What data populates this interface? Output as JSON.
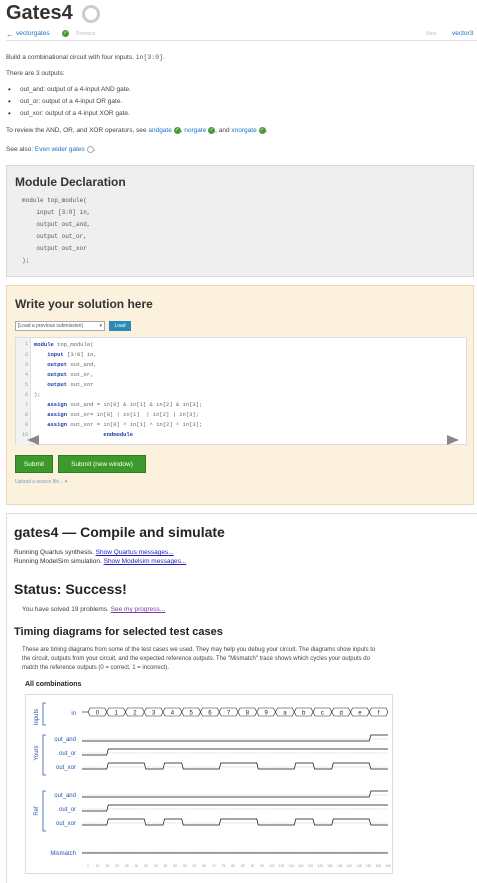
{
  "header": {
    "title": "Gates4",
    "back_link": "vectorgates",
    "previous_label": "Previous",
    "next_label": "Next",
    "next_link": "vector3"
  },
  "problem": {
    "intro_prefix": "Build a combinational circuit with four inputs, ",
    "intro_code": "in[3:0]",
    "intro_suffix": ".",
    "outputs_count": "There are 3 outputs:",
    "outputs": [
      "out_and: output of a 4-input AND gate.",
      "out_or: output of a 4-input OR gate.",
      "out_xor: output of a 4-input XOR gate."
    ],
    "review_prefix": "To review the AND, OR, and XOR operators, see ",
    "review_links": [
      "andgate",
      "norgate",
      "xnorgate"
    ],
    "review_sep1": ", ",
    "review_sep2": ", and ",
    "review_end": ".",
    "see_also_prefix": "See also: ",
    "see_also_link": "Even wider gates",
    "see_also_end": "."
  },
  "declaration": {
    "title": "Module Declaration",
    "lines": [
      "module top_module(",
      "    input [3:0] in,",
      "    output out_and,",
      "    output out_or,",
      "    output out_xor",
      ");"
    ]
  },
  "solution": {
    "title": "Write your solution here",
    "select_value": "[Load a previous submission]",
    "load_label": "Load",
    "line_numbers": [
      "1",
      "2",
      "3",
      "4",
      "5",
      "6",
      "7",
      "8",
      "9",
      "10"
    ],
    "submit_label": "Submit",
    "submit_new_label": "Submit (new window)",
    "upload_label": "Upload a source file..."
  },
  "results": {
    "title": "gates4 — Compile and simulate",
    "line1_prefix": "Running Quartus synthesis. ",
    "line1_link": "Show Quartus messages...",
    "line2_prefix": "Running ModelSim simulation. ",
    "line2_link": "Show Modelsim messages...",
    "status": "Status: Success!",
    "solved_prefix": "You have solved 19 problems. ",
    "solved_link": "See my progress...",
    "timing_title": "Timing diagrams for selected test cases",
    "timing_p1": "These are timing diagrams from some of the test cases we used. They may help you debug your circuit. The diagrams show inputs to",
    "timing_p2": "the circuit, outputs from your circuit, and the expected reference outputs. The \"Mismatch\" trace shows which cycles your outputs do",
    "timing_p3": "match the reference outputs (0 = correct, 1 = incorrect).",
    "all_combinations": "All combinations",
    "group_labels": [
      "Inputs",
      "Yours",
      "Ref"
    ],
    "signals": {
      "in": "in",
      "out_and": "out_and",
      "out_or": "out_or",
      "out_xor": "out_xor",
      "mismatch": "Mismatch"
    },
    "in_values": [
      "0",
      "1",
      "2",
      "3",
      "4",
      "5",
      "6",
      "7",
      "8",
      "9",
      "a",
      "b",
      "c",
      "d",
      "e",
      "f"
    ],
    "time_ticks": [
      "0",
      "10",
      "15",
      "20",
      "25",
      "30",
      "35",
      "40",
      "45",
      "50",
      "55",
      "60",
      "65",
      "70",
      "75",
      "80",
      "85",
      "90",
      "95",
      "100",
      "105",
      "110",
      "115",
      "120",
      "125",
      "130",
      "135",
      "140",
      "145",
      "150",
      "155",
      "160"
    ]
  },
  "colors": {
    "link": "#1a75c8",
    "success_green": "#3c9a2a",
    "signal_label": "#2a56b0"
  }
}
